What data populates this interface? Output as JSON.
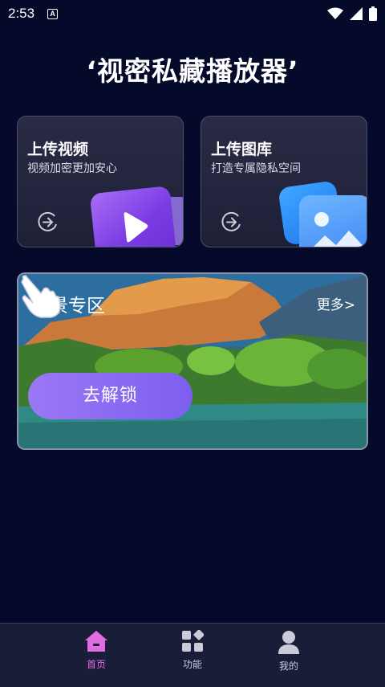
{
  "status_bar": {
    "time": "2:53",
    "notification_glyph": "A"
  },
  "app": {
    "title": "‘视密私藏播放器’"
  },
  "cards": [
    {
      "title": "上传视频",
      "subtitle": "视频加密更加安心"
    },
    {
      "title": "上传图库",
      "subtitle": "打造专属隐私空间"
    }
  ],
  "scenery": {
    "title": "风景专区",
    "more": "更多>",
    "unlock": "去解锁"
  },
  "nav": [
    {
      "label": "首页",
      "icon": "home-icon",
      "active": true
    },
    {
      "label": "功能",
      "icon": "grid-icon",
      "active": false
    },
    {
      "label": "我的",
      "icon": "person-icon",
      "active": false
    }
  ],
  "colors": {
    "background": "#05092a",
    "accent": "#e06de0",
    "button": "#8a6cf2"
  }
}
